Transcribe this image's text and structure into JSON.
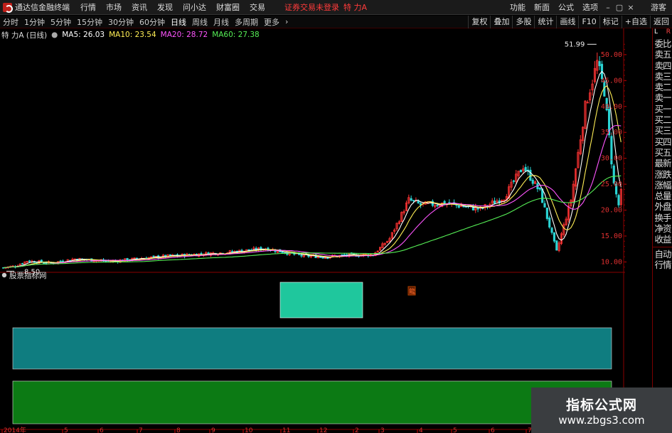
{
  "app": {
    "name": "通达信金融终端"
  },
  "menu": [
    "行情",
    "市场",
    "资讯",
    "发现",
    "问小达",
    "财富圈",
    "交易"
  ],
  "trade_status": "证券交易未登录",
  "stock_title": "特 力A",
  "tools": [
    "功能",
    "新面",
    "公式",
    "选项"
  ],
  "guest": "游客",
  "periods": [
    "分时",
    "1分钟",
    "5分钟",
    "15分钟",
    "30分钟",
    "60分钟",
    "日线",
    "周线",
    "月线",
    "多周期",
    "更多"
  ],
  "active_period": "日线",
  "period_buttons": [
    "复权",
    "叠加",
    "多股",
    "统计",
    "画线",
    "F10",
    "标记",
    "+自选",
    "返回"
  ],
  "info": {
    "name": "特 力A (日线)",
    "ma": [
      {
        "label": "MA5: 26.03",
        "color": "#ffffff"
      },
      {
        "label": "MA10: 23.54",
        "color": "#ffee55"
      },
      {
        "label": "MA20: 28.72",
        "color": "#ff55ff"
      },
      {
        "label": "MA60: 27.38",
        "color": "#55ee55"
      }
    ]
  },
  "indicator_title": "股票指标网",
  "right_panel": {
    "top": [
      "L",
      "R"
    ],
    "items": [
      "委比",
      "卖五",
      "卖四",
      "卖三",
      "卖二",
      "卖一",
      "买一",
      "买二",
      "买三",
      "买四",
      "买五",
      "最新",
      "涨跌",
      "涨幅",
      "总量",
      "外盘",
      "换手",
      "净资",
      "收益"
    ],
    "bottom": [
      "自动",
      "行情"
    ]
  },
  "watermark": {
    "line1": "指标公式网",
    "line2": "www.zbgs3.com"
  },
  "colors": {
    "up": "#ff3333",
    "down": "#2ad4d4",
    "ma5": "#ffffff",
    "ma10": "#ffee55",
    "ma20": "#ff55ff",
    "ma60": "#55ee55",
    "teal_block": "#1fc79d",
    "cyan_band": "#0f7d80",
    "green_band": "#0c7a14"
  },
  "chart_data": {
    "type": "candlestick",
    "ylim": [
      8,
      53
    ],
    "yticks": [
      10,
      15,
      20,
      25,
      30,
      35,
      40,
      45,
      50
    ],
    "ytick_labels": [
      "10.00",
      "15.00",
      "20.00",
      "25.00",
      "30.00",
      "35.00",
      "40.00",
      "45.00",
      "50.00"
    ],
    "x_labels": [
      "2014年",
      "5",
      "6",
      "7",
      "8",
      "9",
      "10",
      "11",
      "12",
      "2",
      "3",
      "4",
      "5",
      "6",
      "7"
    ],
    "annotations": {
      "high": "51.99",
      "low": "8.50",
      "marker": "龍"
    },
    "n_bars": 260,
    "price_path": [
      [
        0,
        8.9
      ],
      [
        5,
        9.2
      ],
      [
        10,
        10.2
      ],
      [
        20,
        9.8
      ],
      [
        30,
        10.6
      ],
      [
        45,
        10.1
      ],
      [
        60,
        10.8
      ],
      [
        75,
        11.3
      ],
      [
        95,
        11.9
      ],
      [
        110,
        12.6
      ],
      [
        125,
        11.2
      ],
      [
        135,
        11.0
      ],
      [
        145,
        11.3
      ],
      [
        155,
        11.4
      ],
      [
        162,
        14.5
      ],
      [
        170,
        22.0
      ],
      [
        175,
        21.0
      ],
      [
        185,
        21.3
      ],
      [
        200,
        20.2
      ],
      [
        210,
        22.5
      ],
      [
        218,
        28.5
      ],
      [
        225,
        23.5
      ],
      [
        232,
        12.0
      ],
      [
        238,
        22.0
      ],
      [
        244,
        40.0
      ],
      [
        249,
        48.5
      ],
      [
        252,
        43.0
      ],
      [
        256,
        25.0
      ],
      [
        258,
        21.0
      ],
      [
        260,
        25.8
      ]
    ],
    "price_labels": [
      "51.99",
      "8.50"
    ],
    "indicator": {
      "blocks": [
        {
          "name": "teal-block"
        },
        {
          "name": "cyan-band"
        },
        {
          "name": "green-band"
        }
      ]
    }
  }
}
